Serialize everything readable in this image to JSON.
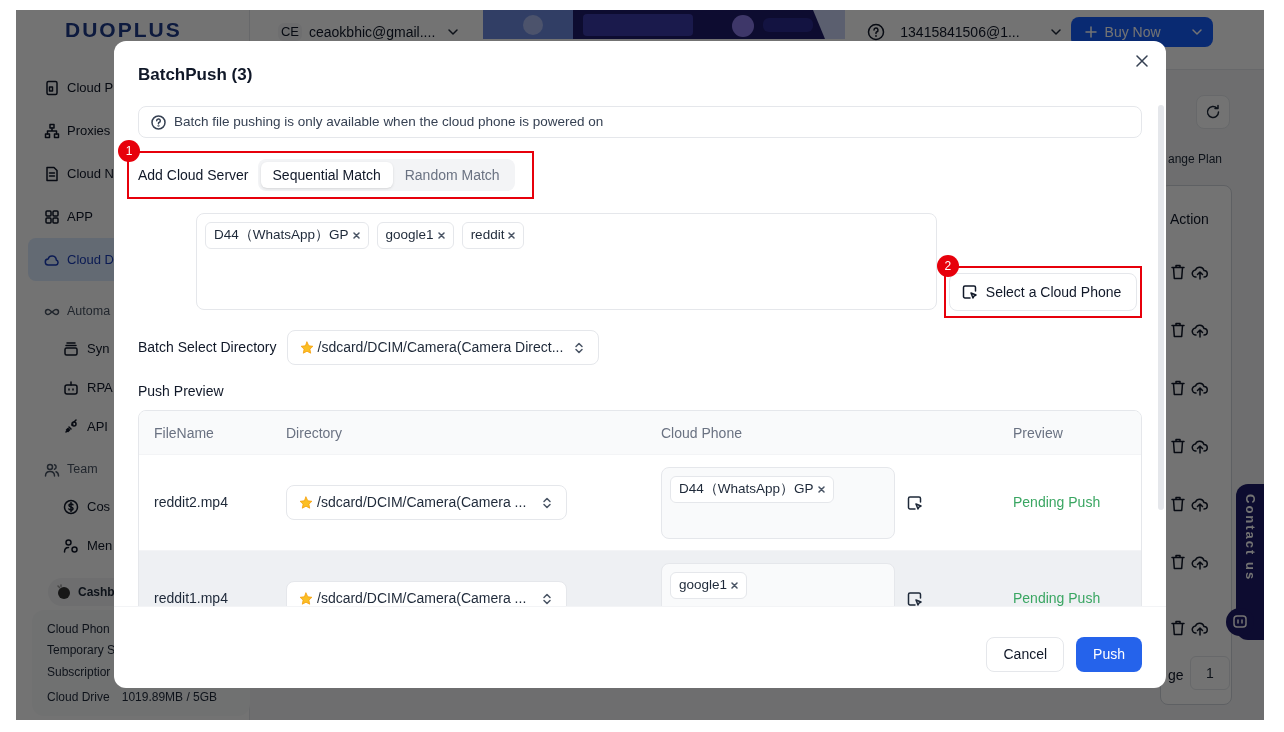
{
  "app": {
    "logo": "DUOPLUS",
    "header": {
      "avatar": "CE",
      "account": "ceaokbhic@gmail....",
      "user": "13415841506@1...",
      "buy_button": "Buy Now"
    },
    "sidebar": {
      "items": [
        {
          "label": "Cloud P",
          "selected": false
        },
        {
          "label": "Proxies",
          "selected": false
        },
        {
          "label": "Cloud N",
          "selected": false
        },
        {
          "label": "APP",
          "selected": false
        },
        {
          "label": "Cloud D",
          "selected": true
        },
        {
          "label": "Automa",
          "selected": false,
          "children": [
            {
              "label": "Syn",
              "selected": false
            },
            {
              "label": "RPA",
              "selected": false
            },
            {
              "label": "API",
              "selected": false
            }
          ]
        },
        {
          "label": "Team",
          "selected": false,
          "children": [
            {
              "label": "Cos",
              "selected": false
            },
            {
              "label": "Men",
              "selected": false
            }
          ]
        }
      ],
      "promo": "Cashb",
      "usage": [
        {
          "label": "Cloud Phon"
        },
        {
          "label": "Temporary S"
        },
        {
          "label": "Subscriptior"
        },
        {
          "label": "Cloud Drive",
          "value": "1019.89MB / 5GB"
        }
      ]
    },
    "content": {
      "plan_link": "ange Plan",
      "action_header": "Action",
      "contact": "Contact us",
      "pagination": {
        "label": "ge",
        "page": "1"
      }
    }
  },
  "dialog": {
    "title": "BatchPush (3)",
    "notice": "Batch file pushing is only available when the cloud phone is powered on",
    "server_label": "Add Cloud Server",
    "match_modes": [
      {
        "label": "Sequential Match",
        "selected": true
      },
      {
        "label": "Random Match",
        "selected": false
      }
    ],
    "selected_phones": [
      "D44（WhatsApp）GP",
      "google1",
      "reddit"
    ],
    "select_button": "Select a Cloud Phone",
    "annotations": [
      "1",
      "2"
    ],
    "directory_label": "Batch Select Directory",
    "directory_value": "/sdcard/DCIM/Camera(Camera Direct...",
    "preview_title": "Push Preview",
    "table": {
      "columns": [
        "FileName",
        "Directory",
        "Cloud Phone",
        "Preview"
      ],
      "rows": [
        {
          "file": "reddit2.mp4",
          "directory": "/sdcard/DCIM/Camera(Camera ...",
          "phones": [
            "D44（WhatsApp）GP"
          ],
          "status": "Pending Push",
          "hovered": false
        },
        {
          "file": "reddit1.mp4",
          "directory": "/sdcard/DCIM/Camera(Camera ...",
          "phones": [
            "google1"
          ],
          "status": "Pending Push",
          "hovered": true
        }
      ]
    },
    "buttons": {
      "cancel": "Cancel",
      "push": "Push"
    }
  }
}
